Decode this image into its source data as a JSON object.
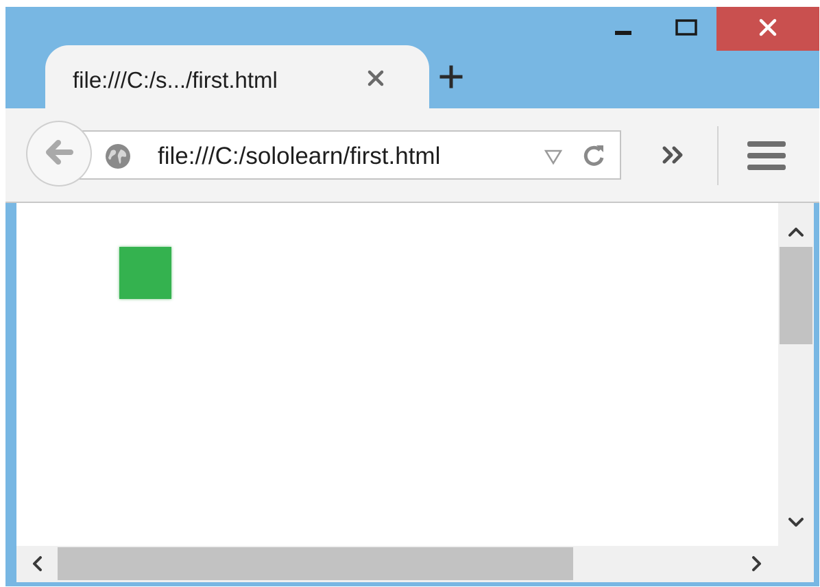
{
  "window": {
    "colors": {
      "frame": "#78b7e3",
      "close_button": "#c9504f",
      "toolbar": "#f3f3f3"
    },
    "controls": {
      "minimize_icon": "minimize-icon",
      "maximize_icon": "maximize-icon",
      "close_icon": "close-icon"
    }
  },
  "tab": {
    "title": "file:///C:/s.../first.html",
    "close_icon": "close-x-icon",
    "new_tab_icon": "plus-icon"
  },
  "toolbar": {
    "back_icon": "back-arrow-icon",
    "url": "file:///C:/sololearn/first.html",
    "site_icon": "globe-icon",
    "dropdown_icon": "triangle-down-icon",
    "reload_icon": "reload-icon",
    "overflow_icon": "double-chevron-icon",
    "menu_icon": "hamburger-menu-icon"
  },
  "content": {
    "element_color": "#34b24f",
    "element_icon": "green-square"
  },
  "scrollbars": {
    "vertical": {
      "up_icon": "chevron-up-icon",
      "down_icon": "chevron-down-icon"
    },
    "horizontal": {
      "left_icon": "chevron-left-icon",
      "right_icon": "chevron-right-icon"
    }
  }
}
